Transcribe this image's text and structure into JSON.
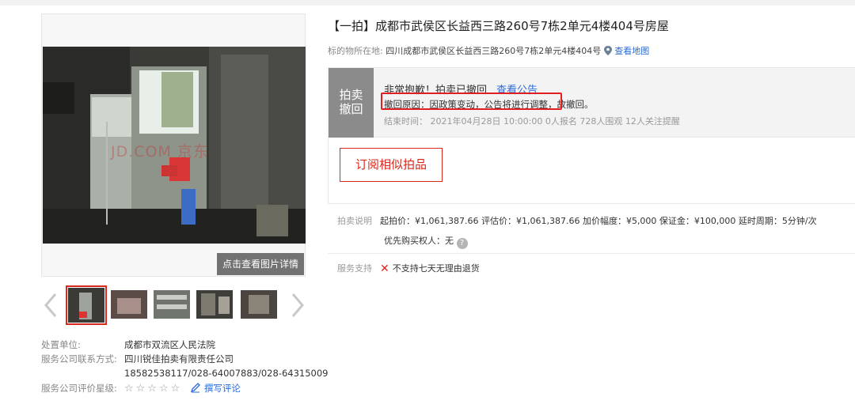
{
  "lot": {
    "title": "【一拍】成都市武侯区长益西三路260号7栋2单元4楼404号房屋",
    "address_label": "标的物所在地:",
    "address_value": "四川成都市武侯区长益西三路260号7栋2单元4楼404号",
    "map_link": "查看地图"
  },
  "status": {
    "tag_line1": "拍卖",
    "tag_line2": "撤回",
    "message": "非常抱歉！拍卖已撤回",
    "notice_link": "查看公告",
    "reason": "撤回原因：因政策变动，公告将进行调整，故撤回。",
    "end_info": "结束时间： 2021年04月28日 10:00:00   0人报名   728人围观   12人关注提醒",
    "highlight_color": "#e02020"
  },
  "subscribe_button": "订阅相似拍品",
  "rules": {
    "label": "拍卖说明",
    "text": "起拍价：¥1,061,387.66   评估价：¥1,061,387.66   加价幅度：¥5,000   保证金：¥100,000   延时周期：5分钟/次",
    "priority": "优先购买权人：无",
    "help_icon": "question-circle-icon"
  },
  "service": {
    "label": "服务支持",
    "text": "不支持七天无理由退货",
    "icon": "cross-icon"
  },
  "gallery": {
    "watermark": "JD.COM 京东",
    "detail_button": "点击查看图片详情",
    "thumb_count": 5
  },
  "seller": {
    "court_label": "处置单位:",
    "court_value": "成都市双流区人民法院",
    "company_label": "服务公司联系方式:",
    "company_value": "四川锐佳拍卖有限责任公司",
    "phones": "18582538117/028-64007883/028-64315009",
    "rating_label": "服务公司评价星级:",
    "stars": "☆☆☆☆☆",
    "review_link": "撰写评论"
  },
  "colors": {
    "accent_red": "#d9281d",
    "link_blue": "#2b6ad8",
    "status_gray": "#8b8b8b"
  }
}
